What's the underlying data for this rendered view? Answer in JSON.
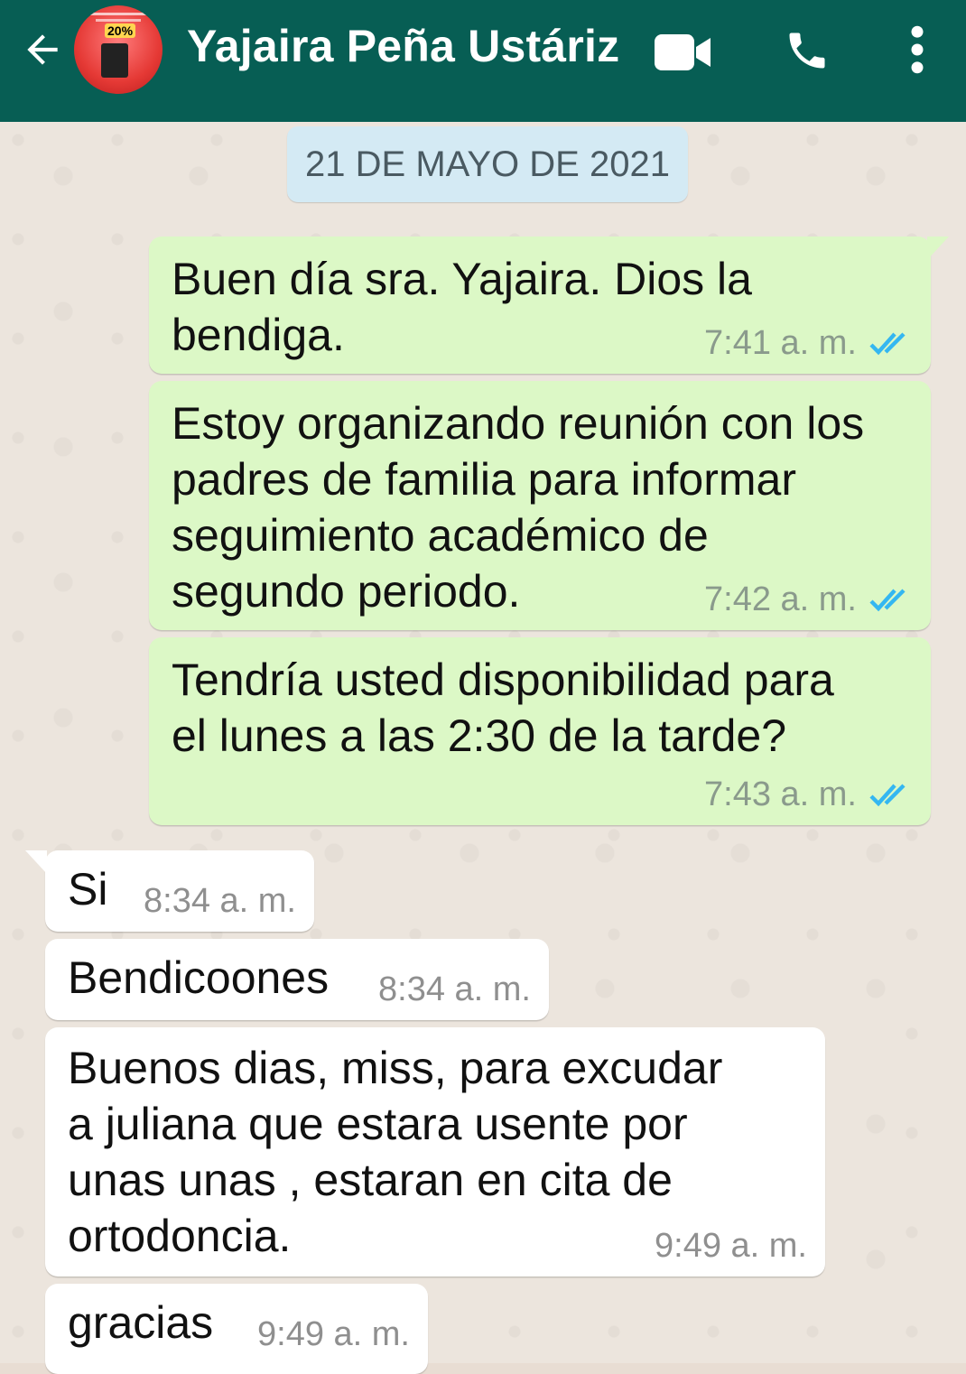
{
  "header": {
    "contact_name": "Yajaira Peña Ustáriz",
    "avatar_badge": "20%",
    "icons": [
      "back-arrow-icon",
      "video-call-icon",
      "phone-icon",
      "more-options-icon"
    ],
    "colors": {
      "bar": "#075e54",
      "outgoing": "#dcf8c6",
      "incoming": "#ffffff",
      "tick": "#34b7f1"
    }
  },
  "date_chip": "21 DE MAYO DE 2021",
  "messages": [
    {
      "direction": "out",
      "text": "Buen día sra. Yajaira. Dios la\nbendiga.",
      "time": "7:41 a. m.",
      "status": "read"
    },
    {
      "direction": "out",
      "text": "Estoy organizando reunión con los\npadres de familia para informar\nseguimiento académico de\nsegundo periodo.",
      "time": "7:42 a. m.",
      "status": "read"
    },
    {
      "direction": "out",
      "text": "Tendría usted disponibilidad para\nel lunes a las 2:30 de la tarde?",
      "time": "7:43 a. m.",
      "status": "read"
    },
    {
      "direction": "in",
      "text": "Si",
      "time": "8:34 a. m."
    },
    {
      "direction": "in",
      "text": "Bendicoones",
      "time": "8:34 a. m."
    },
    {
      "direction": "in",
      "text": "Buenos dias, miss, para excudar\na juliana que estara usente por\nunas unas , estaran en cita de\nortodoncia.",
      "time": "9:49 a. m."
    },
    {
      "direction": "in",
      "text": "gracias",
      "time": "9:49 a. m."
    }
  ]
}
